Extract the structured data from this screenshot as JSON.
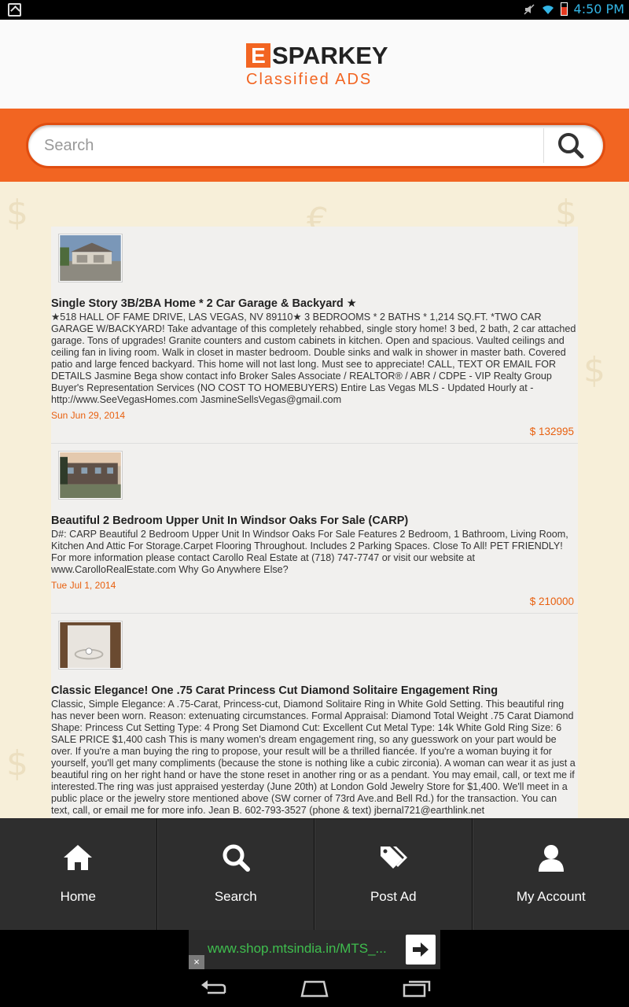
{
  "status_bar": {
    "time": "4:50 PM"
  },
  "header": {
    "logo_letter": "E",
    "logo_name": "SPARKEY",
    "logo_subtitle": "Classified ADS"
  },
  "search": {
    "placeholder": "Search"
  },
  "listings": [
    {
      "title": "Single Story 3B/2BA Home * 2 Car Garage & Backyard ★",
      "description": "★518 HALL OF FAME DRIVE, LAS VEGAS, NV 89110★ 3 BEDROOMS * 2 BATHS * 1,214 SQ.FT. *TWO CAR GARAGE W/BACKYARD! Take advantage of this completely rehabbed, single story home! 3 bed, 2 bath, 2 car attached garage. Tons of upgrades! Granite counters and custom cabinets in kitchen. Open and spacious. Vaulted ceilings and ceiling fan in living room. Walk in closet in master bedroom. Double sinks and walk in shower in master bath. Covered patio and large fenced backyard. This home will not last long. Must see to appreciate! CALL, TEXT OR EMAIL FOR DETAILS Jasmine Bega show contact info Broker Sales Associate / REALTOR® / ABR / CDPE - VIP Realty Group Buyer's Representation Services (NO COST TO HOMEBUYERS) Entire Las Vegas MLS - Updated Hourly at - http://www.SeeVegasHomes.com JasmineSellsVegas@gmail.com",
      "date": "Sun Jun 29, 2014",
      "price": "$ 132995"
    },
    {
      "title": "Beautiful 2 Bedroom Upper Unit In Windsor Oaks For Sale (CARP)",
      "description": "D#: CARP Beautiful 2 Bedroom Upper Unit In Windsor Oaks For Sale Features 2 Bedroom, 1 Bathroom, Living Room, Kitchen And Attic For Storage.Carpet Flooring Throughout. Includes 2 Parking Spaces. Close To All! PET FRIENDLY! For more information please contact Carollo Real Estate at (718) 747-7747 or visit our website at www.CarolloRealEstate.com Why Go Anywhere Else?",
      "date": "Tue Jul 1, 2014",
      "price": "$ 210000"
    },
    {
      "title": "Classic Elegance! One .75 Carat Princess Cut Diamond Solitaire Engagement Ring",
      "description": "Classic, Simple Elegance: A .75-Carat, Princess-cut, Diamond Solitaire Ring in White Gold Setting. This beautiful ring has never been worn. Reason: extenuating circumstances. Formal Appraisal: Diamond Total Weight .75 Carat Diamond Shape: Princess Cut Setting Type: 4 Prong Set Diamond Cut: Excellent Cut Metal Type: 14k White Gold Ring Size: 6 SALE PRICE $1,400 cash This is many women's dream engagement ring, so any guesswork on your part would be over. If you're a man buying the ring to propose, your result will be a thrilled fiancée. If you're a woman buying it for yourself, you'll get many compliments (because the stone is nothing like a cubic zirconia). A woman can wear it as just a beautiful ring on her right hand or have the stone reset in another ring or as a pendant. You may email, call, or text me if interested.The ring was just appraised yesterday (June 20th) at London Gold Jewelry Store for $1,400. We'll meet in a public place or the jewelry store mentioned above (SW corner of 73rd Ave.and Bell Rd.) for the transaction. You can text, call, or email me for more info. Jean B. 602-793-3527 (phone & text) jbernal721@earthlink.net"
    }
  ],
  "bottom_nav": [
    {
      "label": "Home",
      "icon": "home-icon"
    },
    {
      "label": "Search",
      "icon": "search-icon"
    },
    {
      "label": "Post Ad",
      "icon": "tags-icon"
    },
    {
      "label": "My Account",
      "icon": "user-icon"
    }
  ],
  "ad": {
    "text": "www.shop.mtsindia.in/MTS_...",
    "close": "×"
  },
  "colors": {
    "accent": "#f26522",
    "price": "#e8600f",
    "ad_text": "#3fbe4e"
  }
}
